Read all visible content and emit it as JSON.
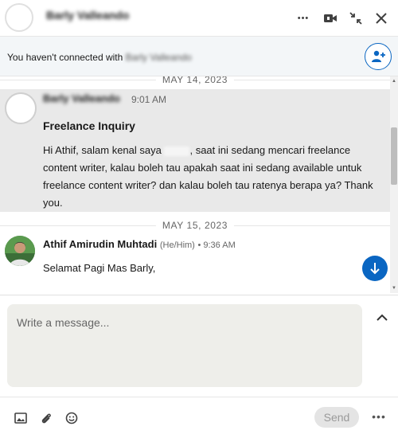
{
  "header": {
    "contact_name": "Barly Valleando",
    "more_glyph": "•••",
    "video_icon": "video-icon",
    "compress_icon": "compress-icon",
    "close_icon": "close-icon"
  },
  "connection_notice": {
    "text_prefix": "You haven't connected with ",
    "contact_name": "Barly Valleando"
  },
  "thread": {
    "date_1": "MAY 14, 2023",
    "message_1": {
      "sender": "Barly Valleando",
      "time": "9:01 AM",
      "subject": "Freelance Inquiry",
      "body_part1": "Hi Athif, salam kenal saya ",
      "body_part2": ", saat ini sedang mencari freelance content writer, kalau boleh tau apakah saat ini sedang available untuk freelance content writer? dan kalau boleh tau ratenya berapa ya? Thank you."
    },
    "date_2": "MAY 15, 2023",
    "message_2": {
      "sender": "Athif Amirudin Muhtadi",
      "pronoun": "(He/Him)",
      "time": "• 9:36 AM",
      "text": "Selamat Pagi Mas Barly,"
    }
  },
  "compose": {
    "placeholder": "Write a message...",
    "value": ""
  },
  "toolbar": {
    "send_label": "Send",
    "more_glyph": "•••"
  },
  "colors": {
    "accent": "#0a66c2",
    "message_highlight": "#e9e9e9",
    "compose_bg": "#eeeeea"
  }
}
